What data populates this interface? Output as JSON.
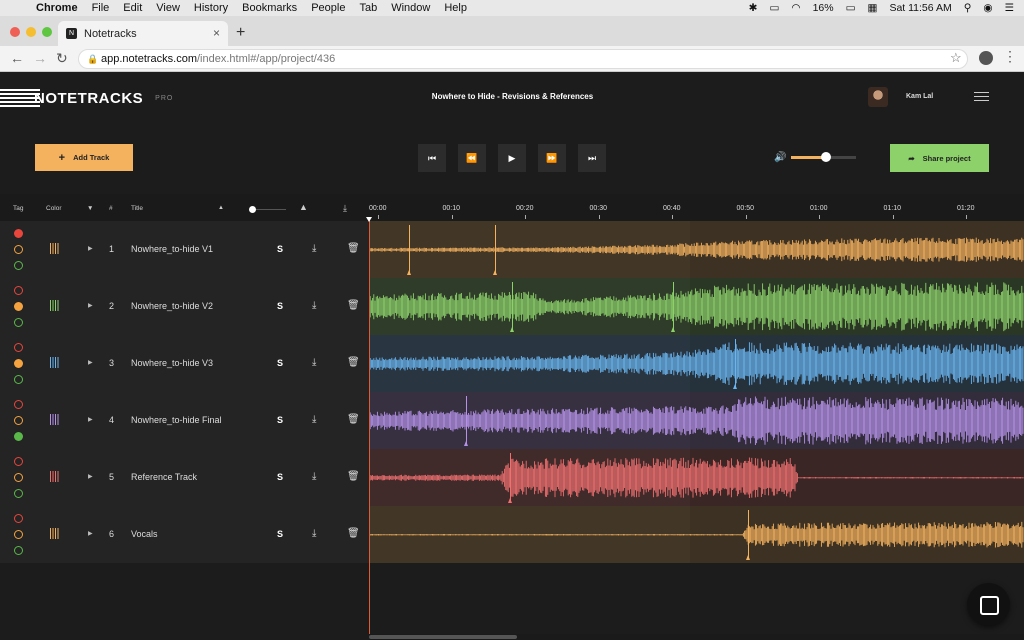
{
  "menubar": {
    "app_name": "Chrome",
    "items": [
      "File",
      "Edit",
      "View",
      "History",
      "Bookmarks",
      "People",
      "Tab",
      "Window",
      "Help"
    ],
    "battery": "16%",
    "clock": "Sat 11:56 AM"
  },
  "browser": {
    "tab_title": "Notetracks",
    "url_host": "app.notetracks.com",
    "url_path": "/index.html#/app/project/436"
  },
  "app": {
    "logo": "NOTETRACKS",
    "logo_badge": "PRO",
    "project_title": "Nowhere to Hide - Revisions & References",
    "user_name": "Kam Lal",
    "add_track_label": "Add Track",
    "share_label": "Share project",
    "volume_level": 0.52
  },
  "columns": {
    "tag": "Tag",
    "color": "Color",
    "number": "#",
    "title": "Title"
  },
  "timeline_ticks": [
    "00:00",
    "00:10",
    "00:20",
    "00:30",
    "00:40",
    "00:50",
    "01:00",
    "01:10",
    "01:20"
  ],
  "tracks": [
    {
      "num": "1",
      "title": "Nowhere_to-hide V1",
      "color": "#f4b25e",
      "tag": "red",
      "solo": "S"
    },
    {
      "num": "2",
      "title": "Nowhere_to-hide V2",
      "color": "#8dd16b",
      "tag": "orange",
      "solo": "S"
    },
    {
      "num": "3",
      "title": "Nowhere_to-hide V3",
      "color": "#6ab4f0",
      "tag": "orange",
      "solo": "S"
    },
    {
      "num": "4",
      "title": "Nowhere_to-hide Final",
      "color": "#b592e8",
      "tag": "green",
      "solo": "S"
    },
    {
      "num": "5",
      "title": "Reference Track",
      "color": "#f07070",
      "tag": "none",
      "solo": "S"
    },
    {
      "num": "6",
      "title": "Vocals",
      "color": "#f4b25e",
      "tag": "none",
      "solo": "S"
    }
  ],
  "colors": {
    "red": "#e8463c",
    "orange": "#f4a340",
    "green": "#5ab84a",
    "accent": "#f4b25e",
    "share": "#8dd16b"
  }
}
